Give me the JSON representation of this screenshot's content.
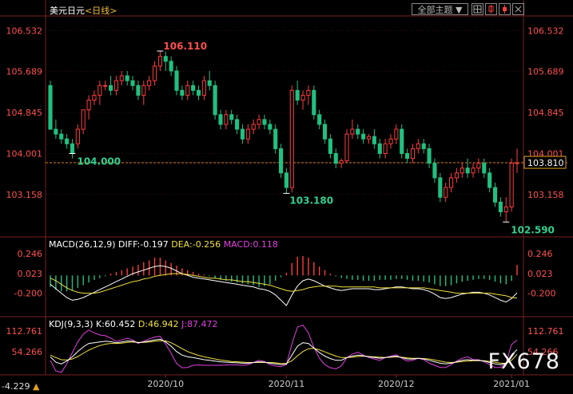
{
  "header": {
    "symbol": "美元日元",
    "period": "<日线>",
    "theme_button": "全部主题",
    "theme_arrow": "▼",
    "toolbar_icons": [
      "grid-icon",
      "candle-icon",
      "bar-icon",
      "close-icon"
    ]
  },
  "colors": {
    "up": "#ff3c3c",
    "down": "#20c080",
    "price_label_axis": "#ff5050",
    "diff": "#ffffff",
    "dea": "#f0e040",
    "macd": "#e040e0",
    "k": "#ffffff",
    "d": "#f0e040",
    "j": "#e040e0",
    "ref_line": "#e08020"
  },
  "main_axis": {
    "ticks": [
      "106.532",
      "105.689",
      "104.845",
      "104.001",
      "103.158"
    ],
    "current_price": "103.810"
  },
  "annotations": {
    "high": "106.110",
    "low_mid": "103.180",
    "low_end": "102.590",
    "level": "104.000"
  },
  "macd_panel": {
    "label": "MACD(26,12,9)",
    "diff_label": "DIFF:",
    "diff": "-0.197",
    "dea_label": "DEA:",
    "dea": "-0.256",
    "macd_label": "MACD:",
    "macd": "0.118",
    "ticks": [
      "0.246",
      "0.023",
      "-0.200"
    ]
  },
  "kdj_panel": {
    "label": "KDJ(9,3,3)",
    "k_label": "K:",
    "k": "60.452",
    "d_label": "D:",
    "d": "46.942",
    "j_label": "J:",
    "j": "87.472",
    "ticks": [
      "112.761",
      "54.266",
      "-4.229"
    ]
  },
  "x_axis": {
    "labels": [
      "2020/10",
      "2020/11",
      "2020/12",
      "2021/01"
    ]
  },
  "watermark": "FX678",
  "chart_data": {
    "type": "candlestick",
    "title": "美元日元<日线>",
    "ylim": [
      102.3,
      106.8
    ],
    "candles": [
      [
        105.4,
        105.5,
        104.5,
        104.5
      ],
      [
        104.5,
        104.7,
        104.3,
        104.4
      ],
      [
        104.4,
        104.5,
        104.2,
        104.3
      ],
      [
        104.3,
        104.4,
        104.1,
        104.2
      ],
      [
        104.2,
        104.3,
        103.9,
        104.0
      ],
      [
        104.2,
        104.6,
        104.1,
        104.5
      ],
      [
        104.5,
        104.9,
        104.4,
        104.9
      ],
      [
        104.9,
        105.2,
        104.7,
        105.1
      ],
      [
        105.1,
        105.3,
        105.0,
        105.2
      ],
      [
        105.2,
        105.5,
        105.0,
        105.4
      ],
      [
        105.4,
        105.5,
        105.3,
        105.4
      ],
      [
        105.4,
        105.6,
        105.2,
        105.3
      ],
      [
        105.3,
        105.6,
        105.2,
        105.5
      ],
      [
        105.5,
        105.7,
        105.4,
        105.6
      ],
      [
        105.6,
        105.7,
        105.4,
        105.5
      ],
      [
        105.5,
        105.6,
        105.3,
        105.4
      ],
      [
        105.4,
        105.5,
        105.1,
        105.2
      ],
      [
        105.2,
        105.5,
        105.0,
        105.4
      ],
      [
        105.4,
        105.6,
        105.3,
        105.5
      ],
      [
        105.5,
        105.9,
        105.4,
        105.8
      ],
      [
        105.8,
        106.11,
        105.7,
        106.0
      ],
      [
        106.0,
        106.1,
        105.7,
        105.9
      ],
      [
        105.9,
        106.0,
        105.6,
        105.7
      ],
      [
        105.7,
        105.8,
        105.2,
        105.3
      ],
      [
        105.3,
        105.4,
        105.1,
        105.2
      ],
      [
        105.2,
        105.5,
        105.1,
        105.4
      ],
      [
        105.4,
        105.5,
        105.2,
        105.3
      ],
      [
        105.3,
        105.4,
        105.1,
        105.2
      ],
      [
        105.2,
        105.6,
        105.1,
        105.5
      ],
      [
        105.5,
        105.7,
        105.3,
        105.4
      ],
      [
        105.4,
        105.5,
        104.7,
        104.8
      ],
      [
        104.8,
        104.9,
        104.5,
        104.6
      ],
      [
        104.6,
        104.9,
        104.5,
        104.8
      ],
      [
        104.8,
        104.9,
        104.6,
        104.7
      ],
      [
        104.7,
        104.8,
        104.4,
        104.5
      ],
      [
        104.5,
        104.6,
        104.2,
        104.3
      ],
      [
        104.3,
        104.6,
        104.2,
        104.5
      ],
      [
        104.5,
        104.7,
        104.4,
        104.6
      ],
      [
        104.6,
        104.8,
        104.5,
        104.7
      ],
      [
        104.7,
        104.8,
        104.5,
        104.6
      ],
      [
        104.6,
        104.7,
        104.4,
        104.5
      ],
      [
        104.5,
        104.6,
        104.0,
        104.1
      ],
      [
        104.1,
        104.2,
        103.5,
        103.6
      ],
      [
        103.6,
        103.7,
        103.18,
        103.3
      ],
      [
        103.3,
        105.4,
        103.2,
        105.3
      ],
      [
        105.3,
        105.5,
        105.0,
        105.1
      ],
      [
        105.1,
        105.3,
        104.9,
        105.2
      ],
      [
        105.2,
        105.4,
        105.0,
        105.3
      ],
      [
        105.3,
        105.4,
        104.7,
        104.8
      ],
      [
        104.8,
        104.9,
        104.5,
        104.6
      ],
      [
        104.6,
        104.7,
        104.2,
        104.3
      ],
      [
        104.3,
        104.4,
        103.9,
        104.0
      ],
      [
        104.0,
        104.1,
        103.7,
        103.8
      ],
      [
        103.8,
        103.9,
        103.7,
        103.85
      ],
      [
        103.85,
        104.5,
        103.8,
        104.4
      ],
      [
        104.4,
        104.7,
        104.3,
        104.5
      ],
      [
        104.5,
        104.6,
        104.3,
        104.4
      ],
      [
        104.4,
        104.5,
        104.2,
        104.3
      ],
      [
        104.3,
        104.4,
        104.2,
        104.35
      ],
      [
        104.35,
        104.5,
        104.1,
        104.2
      ],
      [
        104.2,
        104.3,
        103.9,
        104.0
      ],
      [
        104.0,
        104.3,
        103.9,
        104.2
      ],
      [
        104.2,
        104.4,
        104.1,
        104.3
      ],
      [
        104.3,
        104.6,
        104.2,
        104.5
      ],
      [
        104.5,
        104.6,
        103.9,
        104.0
      ],
      [
        104.0,
        104.1,
        103.8,
        103.9
      ],
      [
        103.9,
        104.2,
        103.8,
        104.1
      ],
      [
        104.1,
        104.3,
        104.0,
        104.2
      ],
      [
        104.2,
        104.3,
        104.0,
        104.1
      ],
      [
        104.1,
        104.2,
        103.7,
        103.8
      ],
      [
        103.8,
        103.9,
        103.4,
        103.5
      ],
      [
        103.5,
        103.6,
        103.0,
        103.1
      ],
      [
        103.1,
        103.4,
        103.0,
        103.3
      ],
      [
        103.3,
        103.6,
        103.2,
        103.5
      ],
      [
        103.5,
        103.7,
        103.4,
        103.6
      ],
      [
        103.6,
        103.8,
        103.5,
        103.7
      ],
      [
        103.7,
        103.9,
        103.5,
        103.6
      ],
      [
        103.6,
        103.8,
        103.5,
        103.7
      ],
      [
        103.7,
        103.9,
        103.6,
        103.8
      ],
      [
        103.8,
        103.9,
        103.5,
        103.6
      ],
      [
        103.6,
        103.7,
        103.2,
        103.3
      ],
      [
        103.3,
        103.4,
        102.9,
        103.0
      ],
      [
        103.0,
        103.1,
        102.7,
        102.8
      ],
      [
        102.8,
        103.1,
        102.59,
        102.9
      ],
      [
        102.9,
        103.9,
        102.8,
        103.8
      ],
      [
        103.8,
        104.1,
        103.6,
        103.81
      ]
    ],
    "annotations": [
      {
        "label": "106.110",
        "type": "high"
      },
      {
        "label": "103.180",
        "type": "low"
      },
      {
        "label": "102.590",
        "type": "low"
      },
      {
        "label": "104.000",
        "type": "level"
      }
    ],
    "reference_line": 103.81,
    "macd": {
      "label": "MACD(26,12,9)",
      "ylim": [
        -0.42,
        0.3
      ],
      "hist": [
        -0.13,
        -0.16,
        -0.18,
        -0.18,
        -0.17,
        -0.14,
        -0.11,
        -0.08,
        -0.05,
        -0.03,
        -0.01,
        0.02,
        0.04,
        0.06,
        0.08,
        0.1,
        0.12,
        0.15,
        0.17,
        0.2,
        0.2,
        0.17,
        0.14,
        0.11,
        0.08,
        0.06,
        0.04,
        0.02,
        0.01,
        -0.01,
        -0.03,
        -0.05,
        -0.06,
        -0.07,
        -0.08,
        -0.09,
        -0.1,
        -0.11,
        -0.13,
        -0.12,
        -0.1,
        -0.06,
        -0.02,
        0.03,
        0.14,
        0.21,
        0.22,
        0.2,
        0.15,
        0.1,
        0.06,
        0.02,
        -0.01,
        -0.03,
        -0.04,
        -0.05,
        -0.05,
        -0.06,
        -0.06,
        -0.06,
        -0.05,
        -0.05,
        -0.05,
        -0.04,
        -0.04,
        -0.05,
        -0.06,
        -0.06,
        -0.07,
        -0.08,
        -0.1,
        -0.12,
        -0.12,
        -0.11,
        -0.09,
        -0.07,
        -0.06,
        -0.05,
        -0.04,
        -0.04,
        -0.05,
        -0.07,
        -0.09,
        -0.1,
        -0.06,
        0.118
      ],
      "diff": [
        -0.1,
        -0.15,
        -0.2,
        -0.25,
        -0.28,
        -0.27,
        -0.25,
        -0.22,
        -0.19,
        -0.16,
        -0.13,
        -0.1,
        -0.07,
        -0.04,
        -0.01,
        0.02,
        0.04,
        0.06,
        0.08,
        0.1,
        0.11,
        0.1,
        0.08,
        0.05,
        0.02,
        -0.0,
        -0.02,
        -0.03,
        -0.04,
        -0.05,
        -0.06,
        -0.07,
        -0.08,
        -0.09,
        -0.1,
        -0.11,
        -0.12,
        -0.13,
        -0.15,
        -0.16,
        -0.18,
        -0.22,
        -0.28,
        -0.34,
        -0.22,
        -0.12,
        -0.06,
        -0.04,
        -0.06,
        -0.09,
        -0.12,
        -0.14,
        -0.16,
        -0.17,
        -0.16,
        -0.15,
        -0.15,
        -0.15,
        -0.15,
        -0.16,
        -0.16,
        -0.15,
        -0.14,
        -0.13,
        -0.13,
        -0.14,
        -0.15,
        -0.15,
        -0.16,
        -0.18,
        -0.21,
        -0.25,
        -0.26,
        -0.25,
        -0.23,
        -0.21,
        -0.2,
        -0.19,
        -0.19,
        -0.2,
        -0.22,
        -0.25,
        -0.28,
        -0.3,
        -0.26,
        -0.197
      ],
      "dea": [
        -0.03,
        -0.06,
        -0.1,
        -0.14,
        -0.17,
        -0.19,
        -0.2,
        -0.2,
        -0.2,
        -0.19,
        -0.17,
        -0.15,
        -0.13,
        -0.11,
        -0.09,
        -0.07,
        -0.06,
        -0.04,
        -0.03,
        -0.01,
        0.0,
        0.01,
        0.02,
        0.02,
        0.02,
        0.01,
        0.0,
        -0.01,
        -0.02,
        -0.03,
        -0.03,
        -0.04,
        -0.05,
        -0.05,
        -0.06,
        -0.07,
        -0.07,
        -0.08,
        -0.09,
        -0.1,
        -0.11,
        -0.13,
        -0.15,
        -0.17,
        -0.18,
        -0.17,
        -0.16,
        -0.14,
        -0.13,
        -0.12,
        -0.12,
        -0.12,
        -0.12,
        -0.13,
        -0.13,
        -0.13,
        -0.13,
        -0.13,
        -0.13,
        -0.13,
        -0.14,
        -0.14,
        -0.14,
        -0.14,
        -0.14,
        -0.14,
        -0.14,
        -0.14,
        -0.14,
        -0.15,
        -0.16,
        -0.17,
        -0.18,
        -0.19,
        -0.2,
        -0.2,
        -0.2,
        -0.2,
        -0.2,
        -0.2,
        -0.2,
        -0.21,
        -0.22,
        -0.23,
        -0.25,
        -0.256
      ]
    },
    "kdj": {
      "label": "KDJ(9,3,3)",
      "ylim": [
        -4.229,
        120
      ],
      "k": [
        40,
        25,
        20,
        28,
        40,
        55,
        68,
        78,
        80,
        82,
        84,
        83,
        80,
        82,
        85,
        84,
        80,
        82,
        85,
        88,
        90,
        82,
        70,
        55,
        45,
        40,
        38,
        35,
        32,
        30,
        28,
        26,
        25,
        24,
        23,
        22,
        22,
        24,
        26,
        25,
        22,
        20,
        18,
        20,
        45,
        70,
        80,
        78,
        65,
        52,
        42,
        35,
        30,
        30,
        38,
        42,
        45,
        43,
        40,
        38,
        36,
        38,
        40,
        42,
        38,
        34,
        34,
        36,
        34,
        30,
        26,
        22,
        20,
        22,
        26,
        30,
        32,
        30,
        30,
        28,
        24,
        20,
        18,
        22,
        45,
        60.452
      ],
      "d": [
        45,
        38,
        32,
        31,
        34,
        41,
        50,
        59,
        66,
        72,
        76,
        78,
        78,
        79,
        81,
        82,
        81,
        81,
        82,
        84,
        86,
        85,
        80,
        72,
        63,
        55,
        49,
        44,
        40,
        37,
        34,
        31,
        29,
        27,
        26,
        25,
        24,
        24,
        24,
        24,
        24,
        23,
        21,
        21,
        29,
        43,
        55,
        63,
        64,
        60,
        54,
        48,
        42,
        38,
        38,
        39,
        41,
        42,
        41,
        40,
        39,
        38,
        39,
        40,
        39,
        37,
        36,
        36,
        35,
        34,
        31,
        28,
        25,
        24,
        25,
        27,
        28,
        29,
        29,
        29,
        27,
        25,
        22,
        22,
        30,
        46.942
      ],
      "j": [
        30,
        0,
        -4,
        20,
        52,
        83,
        104,
        116,
        108,
        102,
        100,
        93,
        84,
        88,
        93,
        88,
        78,
        84,
        91,
        96,
        98,
        76,
        50,
        21,
        9,
        10,
        16,
        17,
        16,
        16,
        16,
        16,
        17,
        18,
        17,
        16,
        18,
        24,
        30,
        27,
        18,
        14,
        12,
        18,
        77,
        124,
        130,
        108,
        67,
        36,
        18,
        9,
        6,
        14,
        38,
        48,
        53,
        45,
        38,
        34,
        30,
        38,
        42,
        46,
        36,
        28,
        30,
        36,
        32,
        22,
        16,
        10,
        10,
        18,
        28,
        36,
        40,
        32,
        32,
        26,
        18,
        10,
        10,
        22,
        75,
        87.472
      ]
    },
    "x_labels": [
      {
        "label": "2020/10",
        "index": 21
      },
      {
        "label": "2020/11",
        "index": 43
      },
      {
        "label": "2020/12",
        "index": 63
      },
      {
        "label": "2021/01",
        "index": 84
      }
    ]
  }
}
